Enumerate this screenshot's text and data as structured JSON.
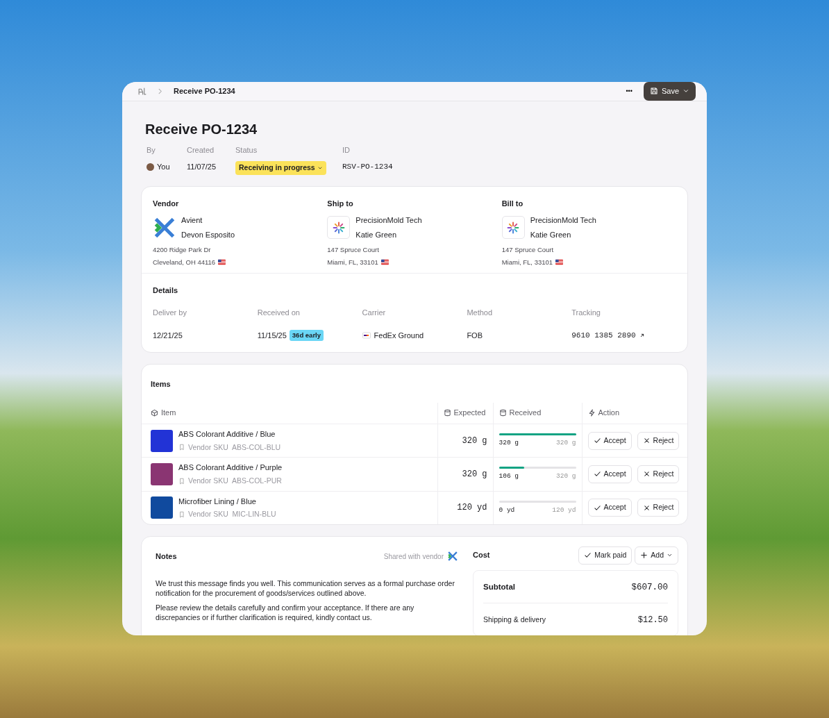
{
  "breadcrumb": {
    "current": "Receive PO-1234"
  },
  "header_actions": {
    "more": "•••",
    "save": "Save"
  },
  "title": "Receive PO-1234",
  "meta": [
    {
      "label": "By",
      "value": "You",
      "kind": "avatar"
    },
    {
      "label": "Created",
      "value": "11/07/25",
      "kind": "text"
    },
    {
      "label": "Status",
      "value": "Receiving in progress",
      "kind": "status"
    },
    {
      "label": "ID",
      "value": "RSV-PO-1234",
      "kind": "mono"
    }
  ],
  "parties": [
    {
      "heading": "Vendor",
      "name": "Avient",
      "contact": "Devon Esposito",
      "address_lines": [
        "4200 Ridge Park Dr",
        "Cleveland, OH 44116"
      ],
      "kind": "chevrons"
    },
    {
      "heading": "Ship to",
      "name": "PrecisionMold Tech",
      "contact": "Katie Green",
      "address_lines": [
        "147 Spruce Court",
        "Miami, FL, 33101"
      ],
      "kind": "burst"
    },
    {
      "heading": "Bill to",
      "name": "PrecisionMold Tech",
      "contact": "Katie Green",
      "address_lines": [
        "147 Spruce Court",
        "Miami, FL, 33101"
      ],
      "kind": "burst"
    }
  ],
  "details": {
    "title": "Details",
    "fields": [
      {
        "label": "Deliver by",
        "value": "12/21/25",
        "kind": "text"
      },
      {
        "label": "Received on",
        "value": "11/15/25",
        "badge": "36d early",
        "kind": "badge"
      },
      {
        "label": "Carrier",
        "value": "FedEx Ground",
        "kind": "carrier"
      },
      {
        "label": "Method",
        "value": "FOB",
        "kind": "text"
      },
      {
        "label": "Tracking",
        "value": "9610 1385 2890",
        "kind": "link"
      }
    ]
  },
  "items": {
    "title": "Items",
    "columns": [
      "Item",
      "Expected",
      "Received",
      "Action"
    ],
    "rows": [
      {
        "name": "ABS Colorant Additive / Blue",
        "sku": "Vendor SKU  ABS-COL-BLU",
        "expected": "320 g",
        "received": "320 g",
        "total": "320 g",
        "level": 1,
        "color": "#2233d6",
        "accept": "Accept",
        "reject": "Reject"
      },
      {
        "name": "ABS Colorant Additive / Purple",
        "sku": "Vendor SKU  ABS-COL-PUR",
        "expected": "320 g",
        "received": "106 g",
        "total": "320 g",
        "level": 0.33,
        "color": "#8a3572",
        "accept": "Accept",
        "reject": "Reject"
      },
      {
        "name": "Microfiber Lining / Blue",
        "sku": "Vendor SKU  MIC-LIN-BLU",
        "expected": "120 yd",
        "received": "0 yd",
        "total": "120 yd",
        "level": 0,
        "color": "#104a9e",
        "accept": "Accept",
        "reject": "Reject"
      }
    ]
  },
  "notes": {
    "title": "Notes",
    "shared": "Shared with vendor",
    "paragraphs": [
      "We trust this message finds you well. This communication serves as a formal purchase order notification for the procurement of goods/services outlined above.",
      "Please review the details carefully and confirm your acceptance. If there are any discrepancies or if further clarification is required, kindly contact us."
    ]
  },
  "cost": {
    "title": "Cost",
    "mark_paid": "Mark paid",
    "add": "Add",
    "lines": [
      {
        "label": "Subtotal",
        "value": "$607.00",
        "kind": "bold"
      },
      {
        "label": "Shipping & delivery",
        "value": "$12.50",
        "kind": "plain"
      }
    ]
  }
}
